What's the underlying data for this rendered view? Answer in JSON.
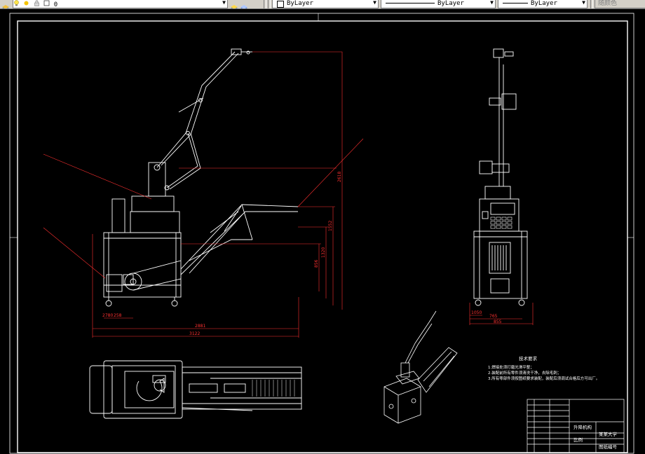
{
  "toolbar": {
    "layer_value": "0",
    "color_value": "ByLayer",
    "linetype_value": "ByLayer",
    "lineweight_value": "ByLayer",
    "plotstyle_value": "随颜色"
  },
  "drawing": {
    "dimensions": {
      "overall_height": "2618",
      "height_1552": "1552",
      "height_1320": "1320",
      "height_856": "856",
      "base_width": "2881",
      "overall_width": "3122",
      "small_left": "2780",
      "small_right": "258",
      "side_depth": "765",
      "side_width": "855",
      "side_small": "1050"
    },
    "tech_requirements": {
      "title": "技术要求",
      "line1": "1.焊接处须打磨光滑平整；",
      "line2": "2.装配前所有零件须清洗干净，去除毛刺；",
      "line3": "3.所有零部件须按图纸要求装配，装配后须调试合格后方可出厂。"
    },
    "title_block": {
      "drawing_name": "升降机构",
      "company": "某某大学",
      "scale": "比例",
      "sheet": "图纸编号"
    }
  }
}
